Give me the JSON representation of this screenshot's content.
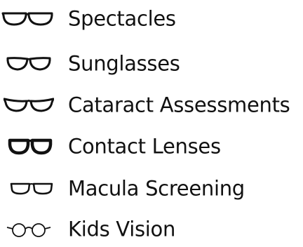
{
  "accent_color": "#111111",
  "services": [
    {
      "label": "Spectacles",
      "icon": "rectangular-spectacles-icon"
    },
    {
      "label": "Sunglasses",
      "icon": "wayfarer-sunglasses-icon"
    },
    {
      "label": "Cataract Assessments",
      "icon": "cat-eye-glasses-icon"
    },
    {
      "label": "Contact Lenses",
      "icon": "bold-frame-glasses-icon"
    },
    {
      "label": "Macula Screening",
      "icon": "slim-rectangular-glasses-icon"
    },
    {
      "label": "Kids Vision",
      "icon": "round-glasses-icon"
    }
  ]
}
